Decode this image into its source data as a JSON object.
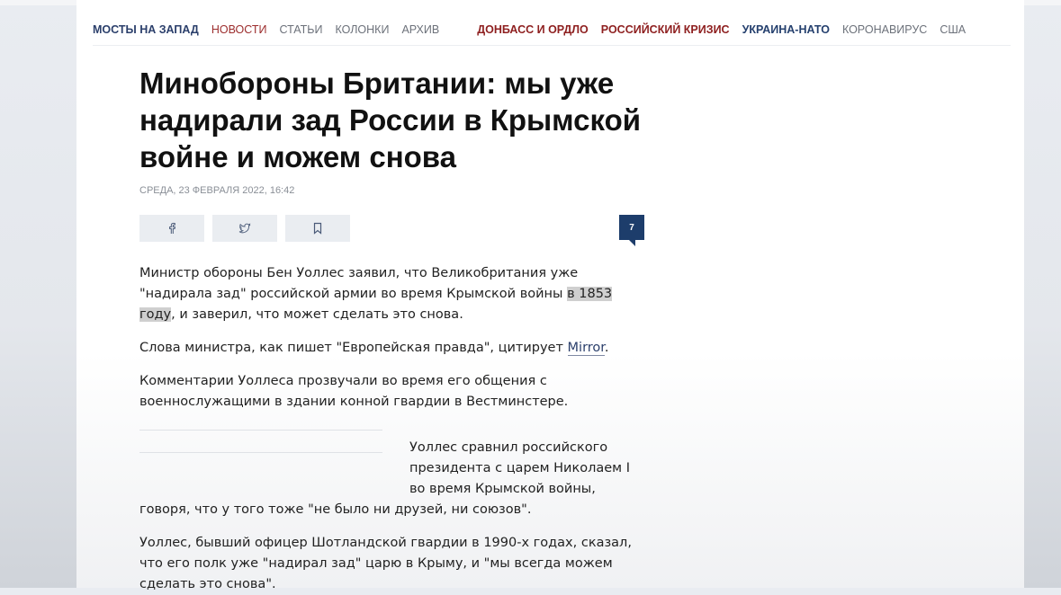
{
  "nav": {
    "brand": "МОСТЫ НА ЗАПАД",
    "items": [
      "НОВОСТИ",
      "СТАТЬИ",
      "КОЛОНКИ",
      "АРХИВ"
    ],
    "topics": [
      "ДОНБАСС И ОРДЛО",
      "РОССИЙСКИЙ КРИЗИС",
      "УКРАИНА-НАТО",
      "КОРОНАВИРУС",
      "США"
    ]
  },
  "article": {
    "title": "Минобороны Британии: мы уже надирали зад России в Крымской войне и можем снова",
    "date": "СРЕДА, 23 ФЕВРАЛЯ 2022, 16:42",
    "comments_count": "7",
    "p1_a": "Министр обороны Бен Уоллес заявил, что Великобритания уже \"надирала зад\" российской армии во время Крымской войны ",
    "p1_hl": "в 1853 году",
    "p1_b": ", и заверил, что может сделать это снова.",
    "p2_a": "Слова министра, как пишет \"Европейская правда\", цитирует ",
    "p2_link": "Mirror",
    "p2_b": ".",
    "p3": "Комментарии Уоллеса прозвучали во время его общения с военнослужащими в здании конной гвардии в Вестминстере.",
    "p4_a": "Уоллес сравнил российского президента с царем Николаем I во время Крымской войны,",
    "p4_b": "говоря, что у того тоже \"не было ни друзей, ни союзов\".",
    "p5": "Уоллес, бывший офицер Шотландской гвардии в 1990-х годах, сказал, что его полк уже \"надирал зад\" царю в Крыму, и \"мы всегда можем сделать это снова\"."
  },
  "icons": {
    "share_facebook": "facebook-icon",
    "share_twitter": "twitter-icon",
    "bookmark": "bookmark-icon"
  }
}
